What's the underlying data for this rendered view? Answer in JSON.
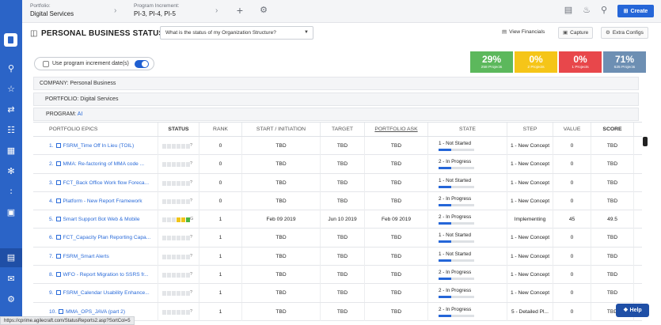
{
  "header": {
    "portfolio_label": "Portfolio:",
    "portfolio_value": "Digital Services",
    "pi_label": "Program Increment:",
    "pi_value": "PI-3, PI-4, PI-5",
    "create_label": "Create",
    "icons": [
      "plus-icon",
      "settings-cogs-icon",
      "clipboard-icon",
      "bell-icon",
      "search-icon",
      "plus-square-icon"
    ]
  },
  "title_row": {
    "page_title": "PERSONAL BUSINESS STATUS",
    "question_select": "What is the status of my Organization Structure?",
    "view_financials": "View Financials",
    "capture": "Capture",
    "extra_configs": "Extra Configs"
  },
  "toggle": {
    "label": "Use program increment date(s)",
    "on": true
  },
  "stats": [
    {
      "pct": "29%",
      "sub": "258 Projects",
      "color": "#5cb85c"
    },
    {
      "pct": "0%",
      "sub": "2 Projects",
      "color": "#f5c518"
    },
    {
      "pct": "0%",
      "sub": "1 Projects",
      "color": "#e8474b"
    },
    {
      "pct": "71%",
      "sub": "625 Projects",
      "color": "#6d8fb3"
    }
  ],
  "context": {
    "company": "COMPANY: Personal Business",
    "portfolio": "PORTFOLIO: Digital Services",
    "program_label": "PROGRAM: ",
    "program_value": "AI"
  },
  "table": {
    "headers": [
      "PORTFOLIO EPICS",
      "STATUS",
      "RANK",
      "START / INITIATION",
      "TARGET",
      "PORTFOLIO ASK",
      "STATE",
      "STEP",
      "VALUE",
      "SCORE"
    ],
    "rows": [
      {
        "epic": "1.   FSRM_Time Off In Lieu (TOIL)",
        "status": "?",
        "status_colors": [
          "n",
          "n",
          "n",
          "n",
          "n",
          "n"
        ],
        "rank": "0",
        "start": "TBD",
        "target": "TBD",
        "ask": "TBD",
        "state": "1 - Not Started",
        "progress": 0.35,
        "step": "1 - New Concept",
        "value": "0",
        "score": "TBD"
      },
      {
        "epic": "2.   MMA: Re-factoring of MMA code ...",
        "status": "?",
        "status_colors": [
          "n",
          "n",
          "n",
          "n",
          "n",
          "n"
        ],
        "rank": "0",
        "start": "TBD",
        "target": "TBD",
        "ask": "TBD",
        "state": "2 - In Progress",
        "progress": 0.35,
        "step": "1 - New Concept",
        "value": "0",
        "score": "TBD"
      },
      {
        "epic": "3.   FCT_Back Office Work flow Foreca...",
        "status": "?",
        "status_colors": [
          "n",
          "n",
          "n",
          "n",
          "n",
          "n"
        ],
        "rank": "0",
        "start": "TBD",
        "target": "TBD",
        "ask": "TBD",
        "state": "1 - Not Started",
        "progress": 0.35,
        "step": "1 - New Concept",
        "value": "0",
        "score": "TBD"
      },
      {
        "epic": "4.   Platform - New Report Framework",
        "status": "?",
        "status_colors": [
          "n",
          "n",
          "n",
          "n",
          "n",
          "n"
        ],
        "rank": "0",
        "start": "TBD",
        "target": "TBD",
        "ask": "TBD",
        "state": "2 - In Progress",
        "progress": 0.35,
        "step": "1 - New Concept",
        "value": "0",
        "score": "TBD"
      },
      {
        "epic": "5.   Smart Support Bot Web & Mobile",
        "status": "G",
        "status_colors": [
          "n",
          "n",
          "n",
          "y",
          "y",
          "g"
        ],
        "rank": "1",
        "start": "Feb 09 2019",
        "target": "Jun 10 2019",
        "ask": "Feb 09 2019",
        "state": "2 - In Progress",
        "progress": 0.35,
        "step": "Implementing",
        "value": "45",
        "score": "49.5"
      },
      {
        "epic": "6.   FCT_Capacity Plan Reporting Capa...",
        "status": "?",
        "status_colors": [
          "n",
          "n",
          "n",
          "n",
          "n",
          "n"
        ],
        "rank": "1",
        "start": "TBD",
        "target": "TBD",
        "ask": "TBD",
        "state": "1 - Not Started",
        "progress": 0.35,
        "step": "1 - New Concept",
        "value": "0",
        "score": "TBD"
      },
      {
        "epic": "7.   FSRM_Smart Alerts",
        "status": "?",
        "status_colors": [
          "n",
          "n",
          "n",
          "n",
          "n",
          "n"
        ],
        "rank": "1",
        "start": "TBD",
        "target": "TBD",
        "ask": "TBD",
        "state": "1 - Not Started",
        "progress": 0.35,
        "step": "1 - New Concept",
        "value": "0",
        "score": "TBD"
      },
      {
        "epic": "8.   WFO - Report Migration to SSRS fr...",
        "status": "?",
        "status_colors": [
          "n",
          "n",
          "n",
          "n",
          "n",
          "n"
        ],
        "rank": "1",
        "start": "TBD",
        "target": "TBD",
        "ask": "TBD",
        "state": "2 - In Progress",
        "progress": 0.35,
        "step": "1 - New Concept",
        "value": "0",
        "score": "TBD"
      },
      {
        "epic": "9.   FSRM_Calendar Usability Enhance...",
        "status": "?",
        "status_colors": [
          "n",
          "n",
          "n",
          "n",
          "n",
          "n"
        ],
        "rank": "1",
        "start": "TBD",
        "target": "TBD",
        "ask": "TBD",
        "state": "2 - In Progress",
        "progress": 0.35,
        "step": "1 - New Concept",
        "value": "0",
        "score": "TBD"
      },
      {
        "epic": "10.   MMA_OPS_JAVA (part 2)",
        "status": "?",
        "status_colors": [
          "n",
          "n",
          "n",
          "n",
          "n",
          "n"
        ],
        "rank": "1",
        "start": "TBD",
        "target": "TBD",
        "ask": "TBD",
        "state": "2 - In Progress",
        "progress": 0.35,
        "step": "5 - Detailed Pl...",
        "value": "0",
        "score": "TBD"
      }
    ]
  },
  "footer": {
    "status_url": "https://cprime.agilecraft.com/StatusReports2.asp?SortCol=5",
    "help_label": "Help"
  }
}
